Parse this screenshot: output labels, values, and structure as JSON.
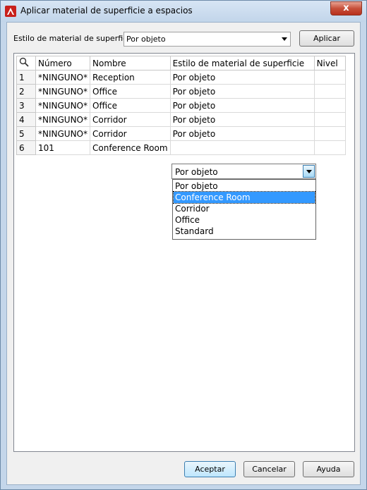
{
  "window": {
    "title": "Aplicar material de superficie a espacios",
    "close": "x"
  },
  "toolbar": {
    "style_label": "Estilo de material de superficie:",
    "style_value": "Por objeto",
    "apply_label": "Aplicar"
  },
  "table": {
    "columns": [
      "Número",
      "Nombre",
      "Estilo de material de superficie",
      "Nivel"
    ],
    "rows": [
      {
        "index": "1",
        "numero": "*NINGUNO*",
        "nombre": "Reception",
        "estilo": "Por objeto",
        "nivel": ""
      },
      {
        "index": "2",
        "numero": "*NINGUNO*",
        "nombre": "Office",
        "estilo": "Por objeto",
        "nivel": ""
      },
      {
        "index": "3",
        "numero": "*NINGUNO*",
        "nombre": "Office",
        "estilo": "Por objeto",
        "nivel": ""
      },
      {
        "index": "4",
        "numero": "*NINGUNO*",
        "nombre": "Corridor",
        "estilo": "Por objeto",
        "nivel": ""
      },
      {
        "index": "5",
        "numero": "*NINGUNO*",
        "nombre": "Corridor",
        "estilo": "Por objeto",
        "nivel": ""
      },
      {
        "index": "6",
        "numero": "101",
        "nombre": "Conference Room",
        "estilo": "Por objeto",
        "nivel": ""
      }
    ]
  },
  "dropdown": {
    "options": [
      "Por objeto",
      "Conference Room",
      "Corridor",
      "Office",
      "Standard"
    ],
    "highlighted": "Conference Room"
  },
  "footer": {
    "ok_label": "Aceptar",
    "cancel_label": "Cancelar",
    "help_label": "Ayuda"
  },
  "icons": {
    "app": "autocad-a-icon",
    "search": "magnifier-icon",
    "close": "close-icon",
    "arrow": "chevron-down-icon"
  },
  "colors": {
    "selection": "#3399ff",
    "window_frame": "#c4d6ea",
    "close_button": "#c7503a"
  }
}
